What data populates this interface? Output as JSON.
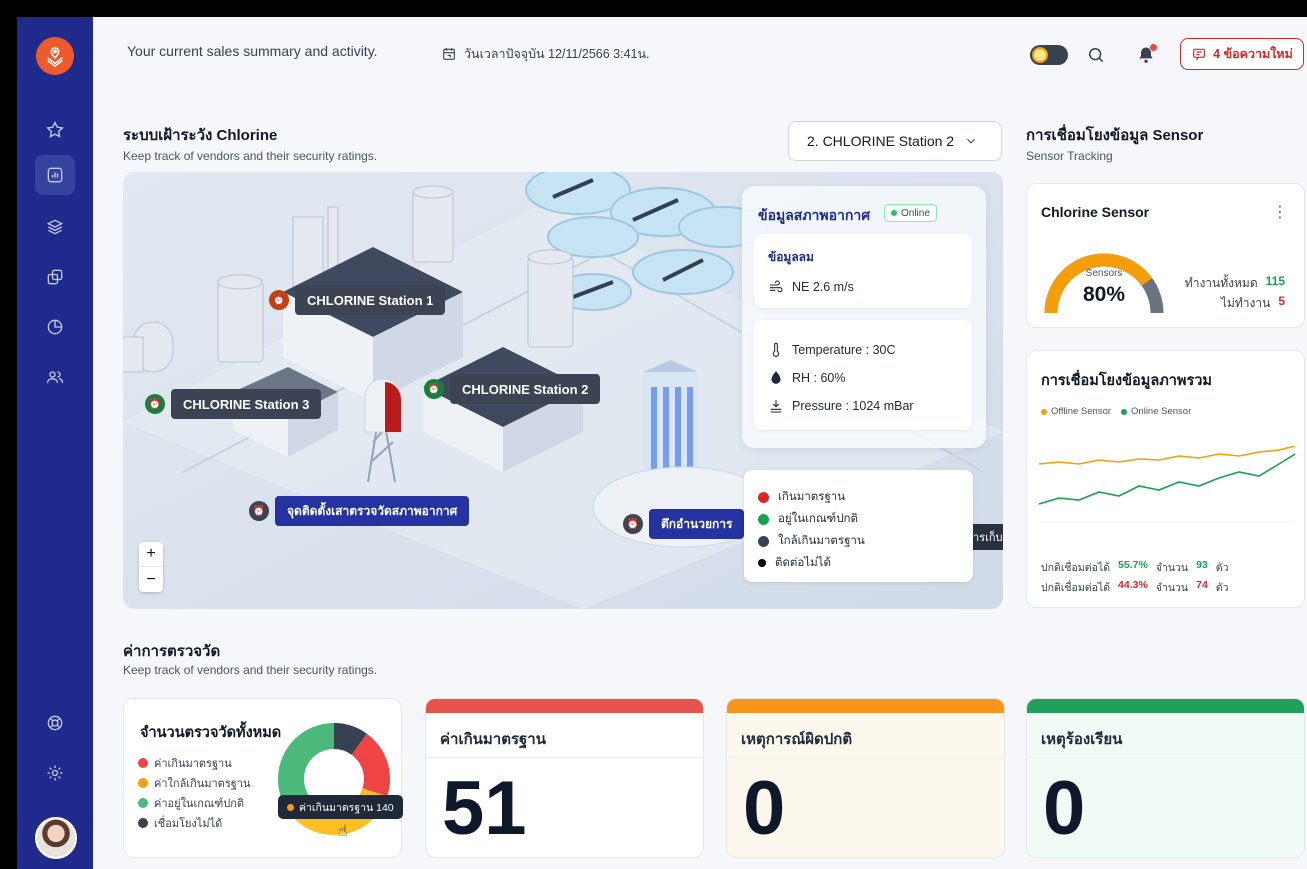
{
  "topbar": {
    "summary": "Your current sales summary and activity.",
    "date": "วันเวลาปัจจุบัน 12/11/2566 3:41น.",
    "messages_button": "4 ข้อความใหม่"
  },
  "monitor": {
    "title": "ระบบเฝ้าระวัง Chlorine",
    "subtitle": "Keep track of vendors and their security ratings.",
    "station_select": "2. CHLORINE Station 2"
  },
  "map": {
    "pins": [
      {
        "label": "CHLORINE Station 1",
        "status_color": "#c2410c"
      },
      {
        "label": "CHLORINE Station 2",
        "status_color": "#15803d"
      },
      {
        "label": "CHLORINE Station 3",
        "status_color": "#15803d"
      },
      {
        "label": "จุดติดตั้งเสาตรวจวัดสภาพอากาศ",
        "status_color": "#3c4352"
      },
      {
        "label": "ตึกอำนวยการ",
        "status_color": "#3c4352"
      }
    ],
    "truncated_label": "ารเก็บ",
    "zoom_in": "+",
    "zoom_out": "−"
  },
  "weather": {
    "title": "ข้อมูลสภาพอากาศ",
    "status": "Online",
    "wind_title": "ข้อมูลลม",
    "wind": "NE 2.6 m/s",
    "temperature": "Temperature : 30C",
    "humidity": "RH : 60%",
    "pressure": "Pressure : 1024 mBar"
  },
  "map_legend": [
    {
      "label": "เกินมาตรฐาน",
      "color": "#dc2626"
    },
    {
      "label": "อยู่ในเกณฑ์ปกติ",
      "color": "#16a34a"
    },
    {
      "label": "ใกล้เกินมาตรฐาน",
      "color": "#374151"
    },
    {
      "label": "ติดต่อไม่ได้",
      "color": "#000000"
    }
  ],
  "sensor_link": {
    "title": "การเชื่อมโยงข้อมูล Sensor",
    "subtitle": "Sensor Tracking"
  },
  "chlorine_sensor": {
    "title": "Chlorine Sensor",
    "gauge_label": "Sensors",
    "gauge_value": "80%",
    "gauge_fraction": 0.8,
    "total_label": "ทำงานทั้งหมด",
    "total_value": "115",
    "inactive_label": "ไม่ทำงาน",
    "inactive_value": "5"
  },
  "overall": {
    "title": "การเชื่อมโยงข้อมูลภาพรวม",
    "legend_offline": "Offline Sensor",
    "legend_online": "Online Sensor",
    "offline_color": "#f59e0b",
    "online_color": "#16a34a",
    "rows": [
      {
        "label": "ปกติเชื่อมต่อได้",
        "percent": "55.7%",
        "count_label": "จำนวน",
        "count": "93",
        "unit": "ตัว",
        "color": "#16a34a"
      },
      {
        "label": "ปกติเชื่อมต่อได้",
        "percent": "44.3%",
        "count_label": "จำนวน",
        "count": "74",
        "unit": "ตัว",
        "color": "#dc2626"
      }
    ]
  },
  "measure": {
    "title": "ค่าการตรวจวัด",
    "subtitle": "Keep track of vendors and their security ratings."
  },
  "total": {
    "title": "จำนวนตรวจวัดทั้งหมด",
    "legend": [
      {
        "label": "ค่าเกินมาตรฐาน",
        "color": "#ef4444"
      },
      {
        "label": "ค่าใกล้เกินมาตรฐาน",
        "color": "#f59e0b"
      },
      {
        "label": "ค่าอยู่ในเกณฑ์ปกติ",
        "color": "#4ab97a"
      },
      {
        "label": "เชื่อมโยงไม่ได้",
        "color": "#374151"
      }
    ],
    "tooltip": "ค่าเกินมาตรฐาน 140"
  },
  "cards": [
    {
      "title": "ค่าเกินมาตรฐาน",
      "value": "51",
      "color": "#e5534b",
      "bg": "#ffffff"
    },
    {
      "title": "เหตุการณ์ผิดปกติ",
      "value": "0",
      "color": "#f7941d",
      "bg": "#fdf8ee"
    },
    {
      "title": "เหตุร้องเรียน",
      "value": "0",
      "color": "#22a05b",
      "bg": "#f1faf4"
    }
  ]
}
